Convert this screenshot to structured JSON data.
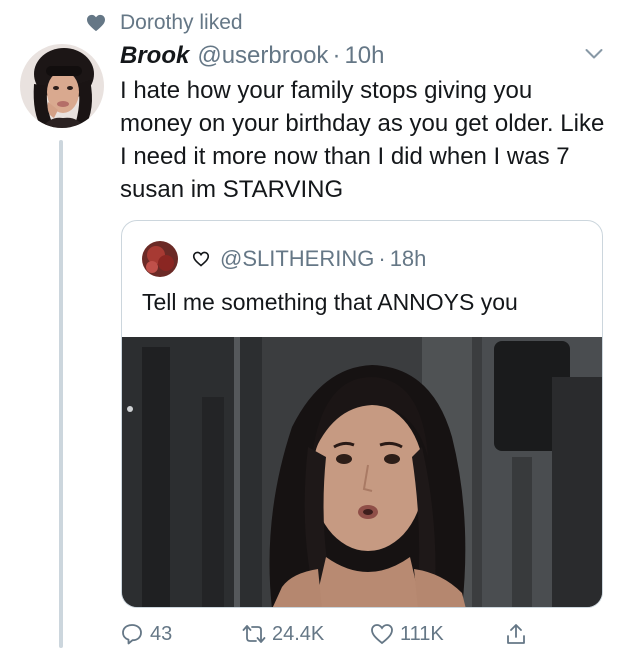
{
  "social_context": {
    "text": "Dorothy liked",
    "icon": "heart-filled-icon"
  },
  "tweet": {
    "author_name": "Brook",
    "author_handle": "@userbrook",
    "separator": "·",
    "time": "10h",
    "text": "I hate how your family stops giving you money on your birthday as you get older. Like I need it more now than I did when I was 7 susan im STARVING"
  },
  "quoted_tweet": {
    "handle": "@SLITHERING",
    "separator": "·",
    "time": "18h",
    "text": "Tell me something that ANNOYS you"
  },
  "actions": {
    "reply_count": "43",
    "retweet_count": "24.4K",
    "like_count": "111K"
  },
  "colors": {
    "text": "#14171a",
    "secondary": "#657786",
    "border": "#ccd6dd"
  }
}
